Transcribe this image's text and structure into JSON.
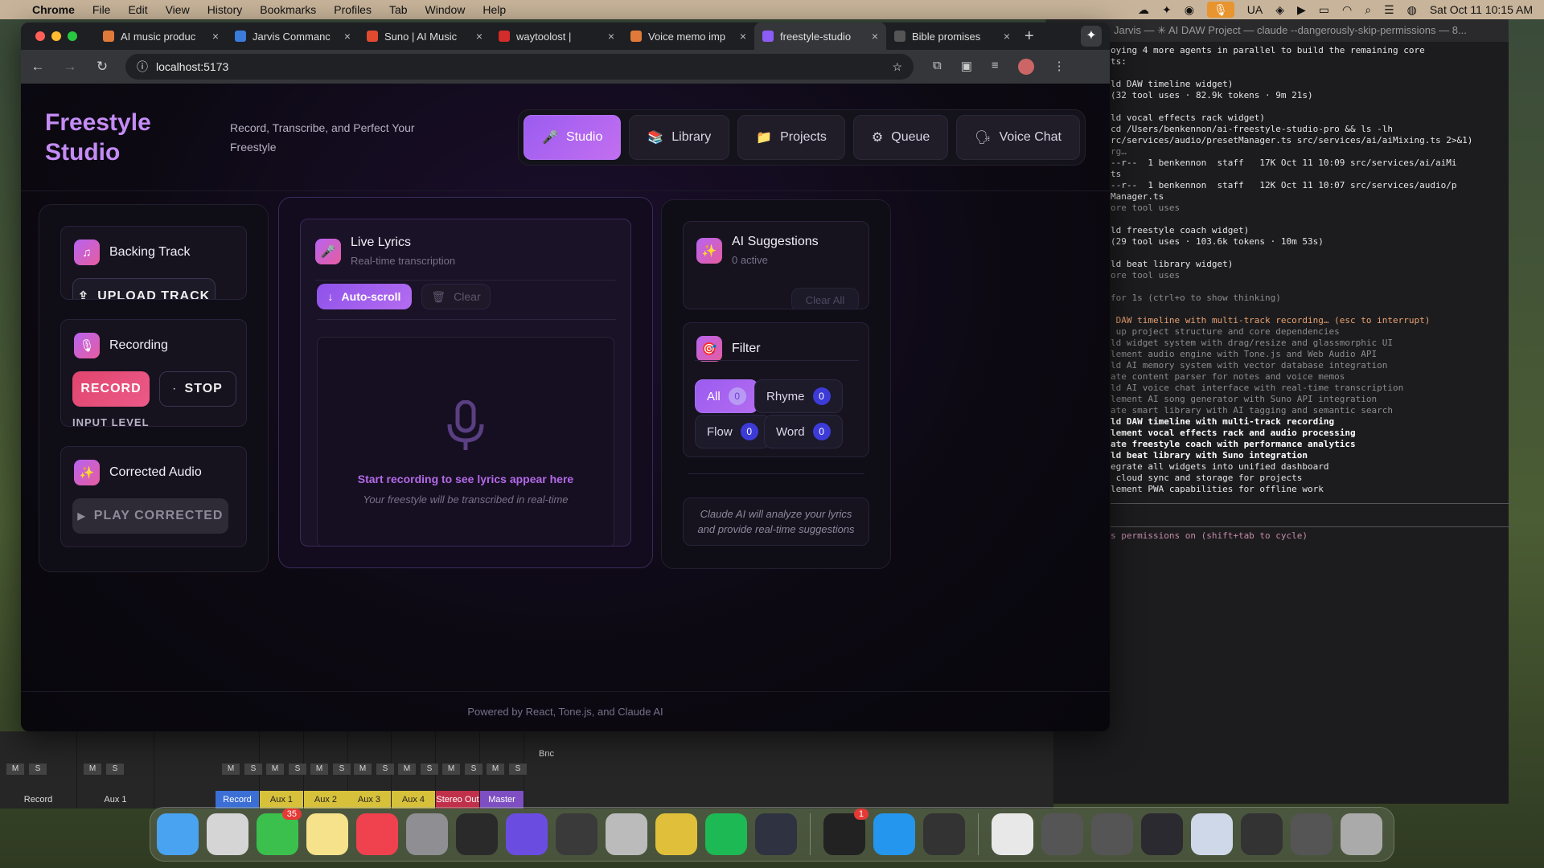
{
  "menubar": {
    "app": "Chrome",
    "menus": [
      "File",
      "Edit",
      "View",
      "History",
      "Bookmarks",
      "Profiles",
      "Tab",
      "Window",
      "Help"
    ],
    "status_ua": "UA",
    "datetime": "Sat Oct 11  10:15 AM"
  },
  "browser": {
    "tabs": [
      {
        "label": "AI music produc",
        "icon_color": "#e07a3a"
      },
      {
        "label": "Jarvis Commanc",
        "icon_color": "#3b7bdc"
      },
      {
        "label": "Suno | AI Music",
        "icon_color": "#e24a2f"
      },
      {
        "label": "waytoolost |",
        "icon_color": "#d42b2b"
      },
      {
        "label": "Voice memo imp",
        "icon_color": "#e07a3a"
      },
      {
        "label": "freestyle-studio",
        "icon_color": "#8b5cf6"
      },
      {
        "label": "Bible promises",
        "icon_color": "#555"
      }
    ],
    "url": "localhost:5173"
  },
  "app": {
    "brand_line1": "Freestyle",
    "brand_line2": "Studio",
    "tagline": "Record, Transcribe, and Perfect Your Freestyle",
    "nav": [
      {
        "label": "Studio",
        "icon": "🎤",
        "active": true
      },
      {
        "label": "Library",
        "icon": "📚",
        "active": false
      },
      {
        "label": "Projects",
        "icon": "📁",
        "active": false
      },
      {
        "label": "Queue",
        "icon": "⚙",
        "active": false
      },
      {
        "label": "Voice Chat",
        "icon": "🗣",
        "active": false
      }
    ],
    "backing_track": {
      "title": "Backing Track",
      "upload": "UPLOAD TRACK"
    },
    "recording": {
      "title": "Recording",
      "record": "RECORD",
      "stop": "STOP",
      "input_level": "INPUT LEVEL"
    },
    "corrected": {
      "title": "Corrected Audio",
      "play": "PLAY CORRECTED"
    },
    "lyrics": {
      "title": "Live Lyrics",
      "subtitle": "Real-time transcription",
      "autoscroll": "Auto-scroll",
      "clear": "Clear",
      "empty_title": "Start recording to see lyrics appear here",
      "empty_sub": "Your freestyle will be transcribed in real-time"
    },
    "suggestions": {
      "title": "AI Suggestions",
      "subtitle": "0 active",
      "clear_all": "Clear All"
    },
    "filter": {
      "title": "Filter",
      "chips": [
        {
          "label": "All",
          "count": "0"
        },
        {
          "label": "Rhyme",
          "count": "0"
        },
        {
          "label": "Flow",
          "count": "0"
        },
        {
          "label": "Word",
          "count": "0"
        }
      ]
    },
    "claude_note": "Claude AI will analyze your lyrics and provide real-time suggestions",
    "footer": "Powered by React, Tone.js, and Claude AI"
  },
  "terminal": {
    "title": "Jarvis — ✳ AI DAW Project — claude --dangerously-skip-permissions — 8...",
    "lines": [
      {
        "t": "oying 4 more agents in parallel to build the remaining core",
        "c": ""
      },
      {
        "t": "ts:",
        "c": ""
      },
      {
        "t": "",
        "c": ""
      },
      {
        "t": "ld DAW timeline widget)",
        "c": ""
      },
      {
        "t": "(32 tool uses · 82.9k tokens · 9m 21s)",
        "c": ""
      },
      {
        "t": "",
        "c": ""
      },
      {
        "t": "ld vocal effects rack widget)",
        "c": ""
      },
      {
        "t": "cd /Users/benkennon/ai-freestyle-studio-pro && ls -lh",
        "c": ""
      },
      {
        "t": "rc/services/audio/presetManager.ts src/services/ai/aiMixing.ts 2>&1)",
        "c": ""
      },
      {
        "t": "rg…",
        "c": "dim"
      },
      {
        "t": "--r--  1 benkennon  staff   17K Oct 11 10:09 src/services/ai/aiMi",
        "c": ""
      },
      {
        "t": "ts",
        "c": ""
      },
      {
        "t": "--r--  1 benkennon  staff   12K Oct 11 10:07 src/services/audio/p",
        "c": ""
      },
      {
        "t": "Manager.ts",
        "c": ""
      },
      {
        "t": "ore tool uses",
        "c": "dim"
      },
      {
        "t": "",
        "c": ""
      },
      {
        "t": "ld freestyle coach widget)",
        "c": ""
      },
      {
        "t": "(29 tool uses · 103.6k tokens · 10m 53s)",
        "c": ""
      },
      {
        "t": "",
        "c": ""
      },
      {
        "t": "ld beat library widget)",
        "c": ""
      },
      {
        "t": "ore tool uses",
        "c": "dim"
      },
      {
        "t": "",
        "c": ""
      },
      {
        "t": "for 1s (ctrl+o to show thinking)",
        "c": "dim"
      },
      {
        "t": "",
        "c": ""
      },
      {
        "t": " DAW timeline with multi-track recording… (esc to interrupt)",
        "c": "orange"
      },
      {
        "t": " up project structure and core dependencies",
        "c": "dim"
      },
      {
        "t": "ld widget system with drag/resize and glassmorphic UI",
        "c": "dim"
      },
      {
        "t": "lement audio engine with Tone.js and Web Audio API",
        "c": "dim"
      },
      {
        "t": "ld AI memory system with vector database integration",
        "c": "dim"
      },
      {
        "t": "ate content parser for notes and voice memos",
        "c": "dim"
      },
      {
        "t": "ld AI voice chat interface with real-time transcription",
        "c": "dim"
      },
      {
        "t": "lement AI song generator with Suno API integration",
        "c": "dim"
      },
      {
        "t": "ate smart library with AI tagging and semantic search",
        "c": "dim"
      },
      {
        "t": "ld DAW timeline with multi-track recording",
        "c": "bold"
      },
      {
        "t": "lement vocal effects rack and audio processing",
        "c": "bold"
      },
      {
        "t": "ate freestyle coach with performance analytics",
        "c": "bold"
      },
      {
        "t": "ld beat library with Suno integration",
        "c": "bold"
      },
      {
        "t": "egrate all widgets into unified dashboard",
        "c": ""
      },
      {
        "t": " cloud sync and storage for projects",
        "c": ""
      },
      {
        "t": "lement PWA capabilities for offline work",
        "c": ""
      }
    ],
    "permissions": "s permissions on (shift+tab to cycle)"
  },
  "daw": {
    "channels": [
      {
        "label": "Record",
        "color": "#262626"
      },
      {
        "label": "Aux 1",
        "color": "#262626"
      },
      {
        "label": "Record",
        "color": "#3b6fd6"
      },
      {
        "label": "Aux 1",
        "color": "#d7c13b"
      },
      {
        "label": "Aux 2",
        "color": "#d7c13b"
      },
      {
        "label": "Aux 3",
        "color": "#d7c13b"
      },
      {
        "label": "Aux 4",
        "color": "#d7c13b"
      },
      {
        "label": "Stereo Out",
        "color": "#c1304a"
      },
      {
        "label": "Master",
        "color": "#7d4fc2"
      }
    ],
    "bnc": "Bnc"
  },
  "dock": {
    "icons": [
      {
        "name": "finder-icon",
        "color": "#4aa3f0"
      },
      {
        "name": "launchpad-icon",
        "color": "#d5d5d5"
      },
      {
        "name": "messages-icon",
        "color": "#3bc04e",
        "badge": "35"
      },
      {
        "name": "notes-icon",
        "color": "#f5e28a"
      },
      {
        "name": "music-icon",
        "color": "#f0424e"
      },
      {
        "name": "settings-icon",
        "color": "#8e8e93"
      },
      {
        "name": "logic-icon",
        "color": "#2a2a2a"
      },
      {
        "name": "arc-icon",
        "color": "#6a4de0"
      },
      {
        "name": "mixer-icon",
        "color": "#3a3a3a"
      },
      {
        "name": "disk-utility-icon",
        "color": "#bbbbbb"
      },
      {
        "name": "chrome-icon",
        "color": "#e0c03a"
      },
      {
        "name": "spotify-icon",
        "color": "#1db954"
      },
      {
        "name": "electron-icon",
        "color": "#2f3241"
      },
      {
        "name": "terminal-icon",
        "color": "#222",
        "badge": "1"
      },
      {
        "name": "docker-icon",
        "color": "#2496ed"
      },
      {
        "name": "audio-app-icon",
        "color": "#333"
      },
      {
        "name": "music-file-icon",
        "color": "#e8e8e8"
      },
      {
        "name": "window-thumb-1",
        "color": "#555"
      },
      {
        "name": "window-thumb-2",
        "color": "#555"
      },
      {
        "name": "window-thumb-3",
        "color": "#2a2a30"
      },
      {
        "name": "window-thumb-4",
        "color": "#cfd8e8"
      },
      {
        "name": "window-thumb-5",
        "color": "#333"
      },
      {
        "name": "window-thumb-6",
        "color": "#555"
      },
      {
        "name": "trash-icon",
        "color": "#aaa"
      }
    ]
  }
}
